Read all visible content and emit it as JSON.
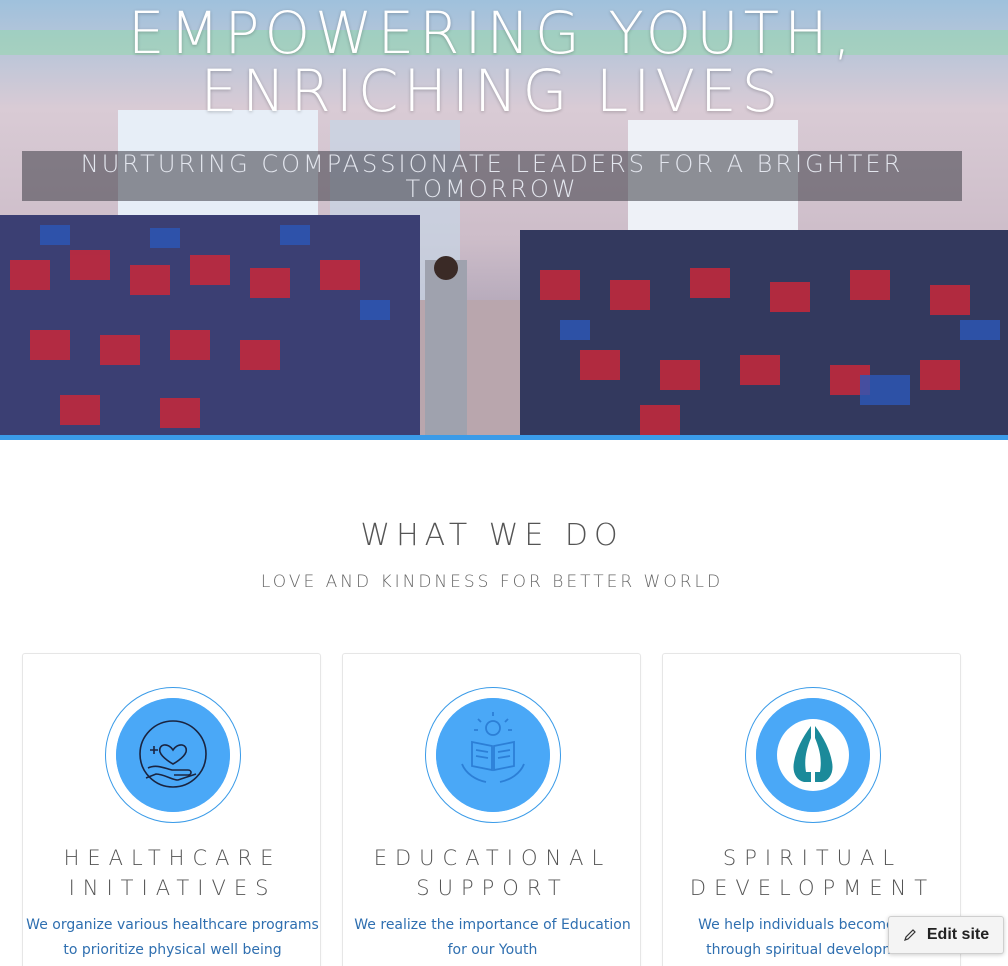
{
  "hero": {
    "title_line1": "EMPOWERING YOUTH,",
    "title_line2": "ENRICHING LIVES",
    "subtitle_line1": "NURTURING COMPASSIONATE LEADERS FOR A BRIGHTER",
    "subtitle_line2": "TOMORROW",
    "accent_color": "#3a9be8"
  },
  "section": {
    "title": "WHAT WE DO",
    "subtitle": "LOVE AND KINDNESS FOR BETTER WORLD"
  },
  "cards": [
    {
      "icon": "healthcare-hand-heart-icon",
      "title_line1": "HEALTHCARE",
      "title_line2": "INITIATIVES",
      "text_line1": "We organize various healthcare programs",
      "text_line2": "to prioritize physical well being"
    },
    {
      "icon": "education-book-lightbulb-icon",
      "title_line1": "EDUCATIONAL",
      "title_line2": "SUPPORT",
      "text_line1": "We realize the importance of Education",
      "text_line2": "for our Youth"
    },
    {
      "icon": "praying-hands-icon",
      "title_line1": "SPIRITUAL",
      "title_line2": "DEVELOPMENT",
      "text_line1": "We help individuals become well",
      "text_line2": "through spiritual development"
    }
  ],
  "edit_site": {
    "label": "Edit site",
    "icon": "pencil-icon"
  },
  "colors": {
    "icon_disc": "#4aa8f7",
    "card_text": "#2f6fb0"
  }
}
